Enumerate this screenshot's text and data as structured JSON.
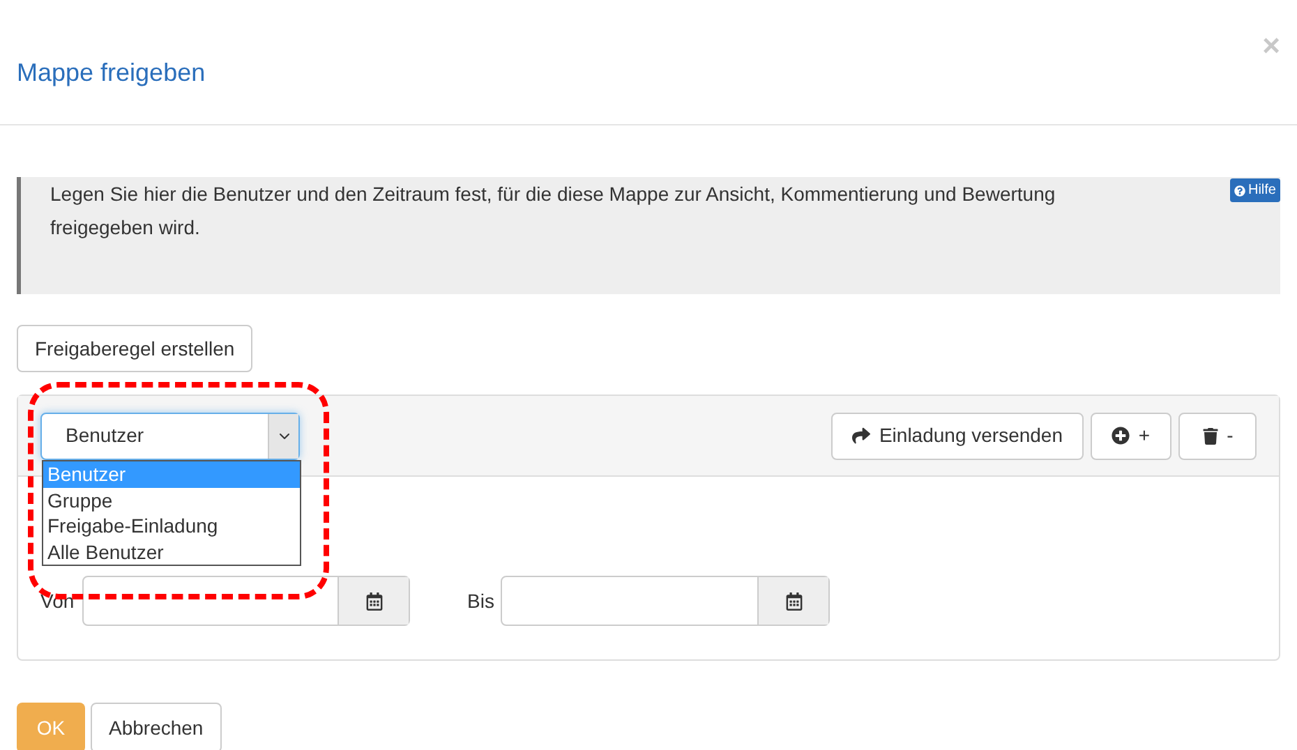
{
  "dialog": {
    "title": "Mappe freigeben",
    "close": "×"
  },
  "info": {
    "text": "Legen Sie hier die Benutzer und den Zeitraum fest, für die diese Mappe zur Ansicht, Kommentierung und Bewertung freigegeben wird.",
    "help": "Hilfe"
  },
  "create_rule_button": "Freigaberegel erstellen",
  "rule": {
    "select": {
      "value": "Benutzer",
      "expanded": true,
      "options": [
        {
          "label": "Benutzer",
          "selected": true
        },
        {
          "label": "Gruppe",
          "selected": false
        },
        {
          "label": "Freigabe-Einladung",
          "selected": false
        },
        {
          "label": "Alle Benutzer",
          "selected": false
        }
      ]
    },
    "toolbar": {
      "invite": "Einladung versenden",
      "add": "+",
      "remove": "-"
    },
    "from_label": "Von",
    "to_label": "Bis"
  },
  "footer": {
    "ok": "OK",
    "cancel": "Abbrechen"
  }
}
